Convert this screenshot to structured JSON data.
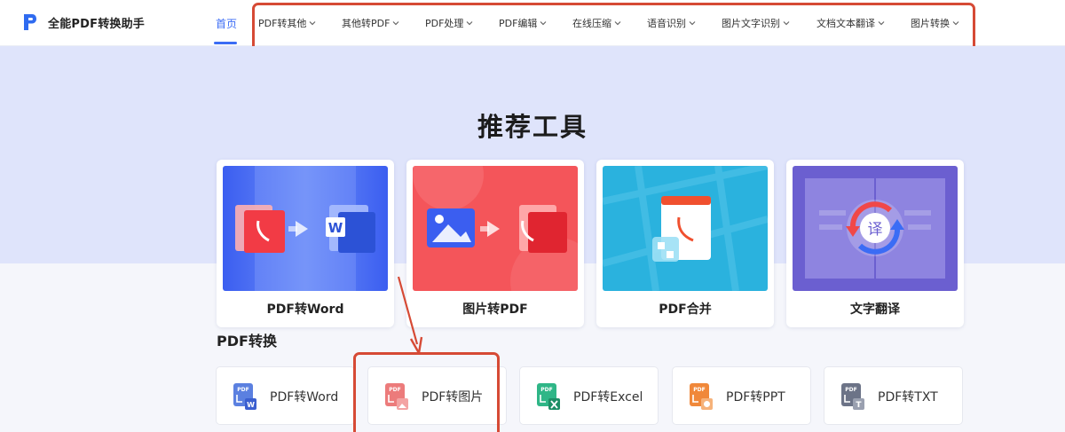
{
  "header": {
    "brand_name": "全能PDF转换助手",
    "home_label": "首页",
    "nav_items": [
      {
        "label": "PDF转其他"
      },
      {
        "label": "其他转PDF"
      },
      {
        "label": "PDF处理"
      },
      {
        "label": "PDF编辑"
      },
      {
        "label": "在线压缩"
      },
      {
        "label": "语音识别"
      },
      {
        "label": "图片文字识别"
      },
      {
        "label": "文档文本翻译"
      },
      {
        "label": "图片转换"
      }
    ]
  },
  "recommended": {
    "title": "推荐工具",
    "cards": [
      {
        "label": "PDF转Word"
      },
      {
        "label": "图片转PDF"
      },
      {
        "label": "PDF合并"
      },
      {
        "label": "文字翻译",
        "badge": "译"
      }
    ]
  },
  "pdf_convert": {
    "title": "PDF转换",
    "tools": [
      {
        "label": "PDF转Word",
        "icon_text": "PDF"
      },
      {
        "label": "PDF转图片",
        "icon_text": "PDF"
      },
      {
        "label": "PDF转Excel",
        "icon_text": "PDF"
      },
      {
        "label": "PDF转PPT",
        "icon_text": "PDF"
      },
      {
        "label": "PDF转TXT",
        "icon_text": "PDF"
      }
    ]
  },
  "colors": {
    "accent": "#3b6cf5",
    "highlight_border": "#d64a35",
    "hero_background": "#dfe4fb",
    "word_icon": "#5b80e0",
    "image_icon": "#ec7b7b",
    "excel_icon": "#2fb687",
    "ppt_icon": "#f0883a",
    "txt_icon": "#6c7387"
  },
  "annotations": {
    "highlighted_region": "top navigation menu",
    "highlighted_tool": "PDF转图片"
  }
}
